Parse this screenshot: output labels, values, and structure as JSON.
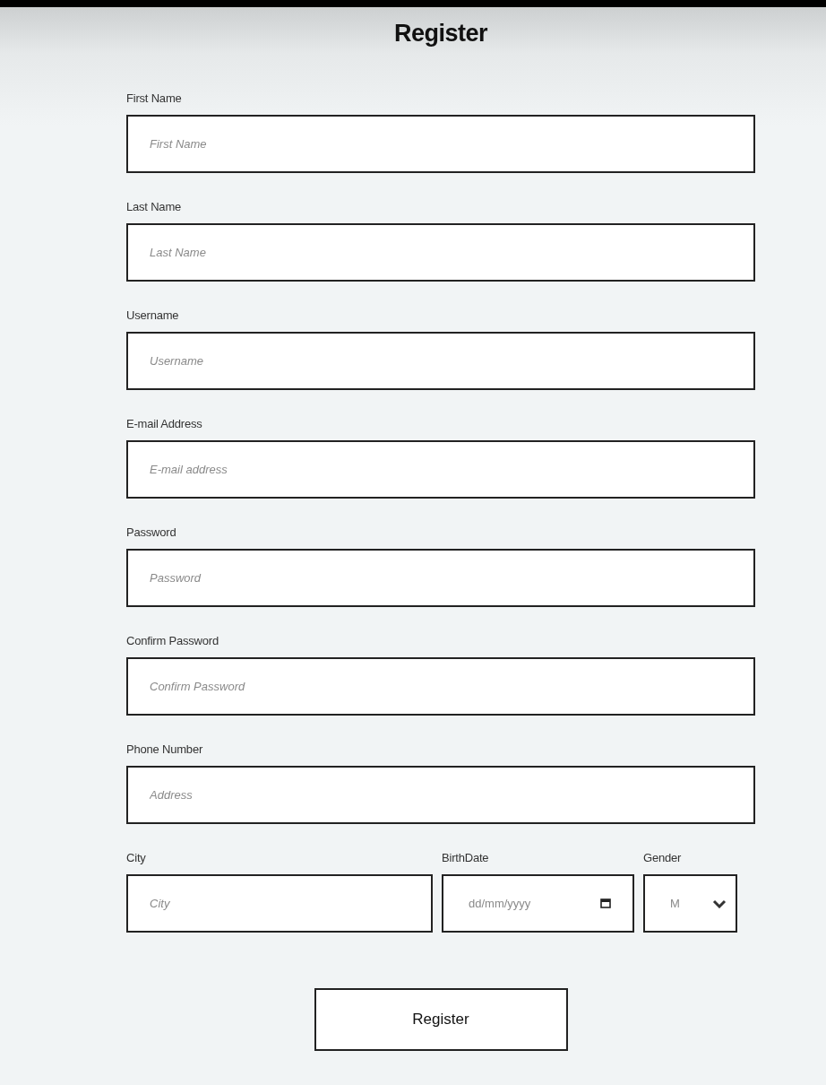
{
  "title": "Register",
  "fields": [
    {
      "label": "First Name",
      "placeholder": "First Name"
    },
    {
      "label": "Last Name",
      "placeholder": "Last Name"
    },
    {
      "label": "Username",
      "placeholder": "Username"
    },
    {
      "label": "E-mail Address",
      "placeholder": "E-mail address"
    },
    {
      "label": "Password",
      "placeholder": "Password"
    },
    {
      "label": "Confirm Password",
      "placeholder": "Confirm Password"
    },
    {
      "label": "Phone Number",
      "placeholder": "Address"
    }
  ],
  "bottom_row": [
    {
      "kind": "text",
      "label": "City",
      "placeholder": "City"
    },
    {
      "kind": "date",
      "label": "BirthDate",
      "placeholder": "dd/mm/yyyy"
    },
    {
      "kind": "select",
      "label": "Gender",
      "value": "M"
    }
  ],
  "submit": "Register"
}
